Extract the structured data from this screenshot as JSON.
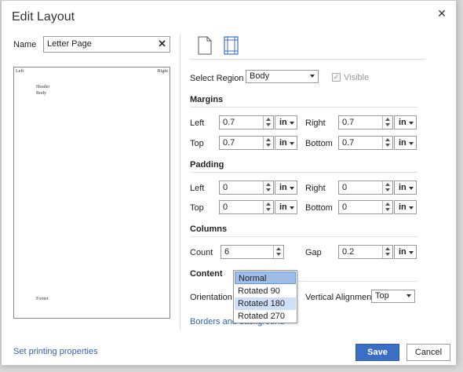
{
  "dialog": {
    "title": "Edit Layout",
    "name_label": "Name",
    "name_value": "Letter Page"
  },
  "preview": {
    "left": "Left",
    "right": "Right",
    "header": "Header",
    "body": "Body",
    "footer": "Footer"
  },
  "region": {
    "label": "Select Region",
    "value": "Body",
    "visible_label": "Visible",
    "visible_checked": true
  },
  "margins": {
    "title": "Margins",
    "left_label": "Left",
    "left_value": "0.7",
    "left_unit": "in",
    "right_label": "Right",
    "right_value": "0.7",
    "right_unit": "in",
    "top_label": "Top",
    "top_value": "0.7",
    "top_unit": "in",
    "bottom_label": "Bottom",
    "bottom_value": "0.7",
    "bottom_unit": "in"
  },
  "padding": {
    "title": "Padding",
    "left_label": "Left",
    "left_value": "0",
    "left_unit": "in",
    "right_label": "Right",
    "right_value": "0",
    "right_unit": "in",
    "top_label": "Top",
    "top_value": "0",
    "top_unit": "in",
    "bottom_label": "Bottom",
    "bottom_value": "0",
    "bottom_unit": "in"
  },
  "columns": {
    "title": "Columns",
    "count_label": "Count",
    "count_value": "6",
    "gap_label": "Gap",
    "gap_value": "0.2",
    "gap_unit": "in"
  },
  "content": {
    "title": "Content",
    "orientation_label": "Orientation",
    "orientation_options": [
      "Normal",
      "Rotated 90",
      "Rotated 180",
      "Rotated 270"
    ],
    "orientation_selected": "Normal",
    "orientation_hovered": "Rotated 180",
    "valign_label": "Vertical Alignment",
    "valign_value": "Top",
    "borders_link": "Borders and background"
  },
  "footer": {
    "print_link": "Set printing properties",
    "save_label": "Save",
    "cancel_label": "Cancel"
  },
  "colors": {
    "accent": "#3b6fc4",
    "link": "#2f63b3",
    "selected_option": "#9fbde8",
    "hover_option": "#cfdff5"
  }
}
